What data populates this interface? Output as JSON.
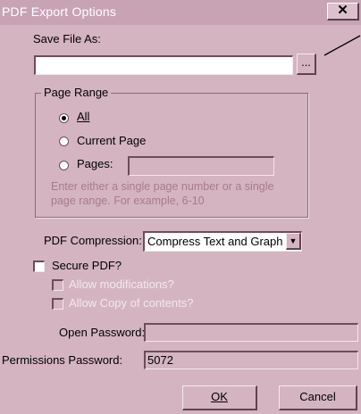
{
  "window": {
    "title": "PDF Export Options",
    "close_glyph": "✕"
  },
  "save_file": {
    "label": "Save File As:",
    "value": "",
    "browse_label": "..."
  },
  "page_range": {
    "group_label": "Page Range",
    "options": [
      {
        "label": "All",
        "selected": true
      },
      {
        "label": "Current Page",
        "selected": false
      },
      {
        "label": "Pages:",
        "selected": false
      }
    ],
    "pages_value": "",
    "hint": "Enter either a single page number or a single page range. For example, 6-10"
  },
  "compression": {
    "label": "PDF Compression:",
    "value": "Compress Text and Graph",
    "dropdown_glyph": "▼"
  },
  "security": {
    "secure_label": "Secure PDF?",
    "secure_checked": false,
    "allow_modifications_label": "Allow modifications?",
    "allow_copy_label": "Allow Copy of contents?",
    "open_password_label": "Open Password:",
    "open_password_value": "",
    "permissions_password_label": "Permissions Password:",
    "permissions_password_value": "5072"
  },
  "buttons": {
    "ok": "OK",
    "cancel": "Cancel"
  },
  "colors": {
    "dialog_bg": "#d4b4c1",
    "titlebar": "#c8a3b3",
    "hint_text": "#a87a8d"
  }
}
